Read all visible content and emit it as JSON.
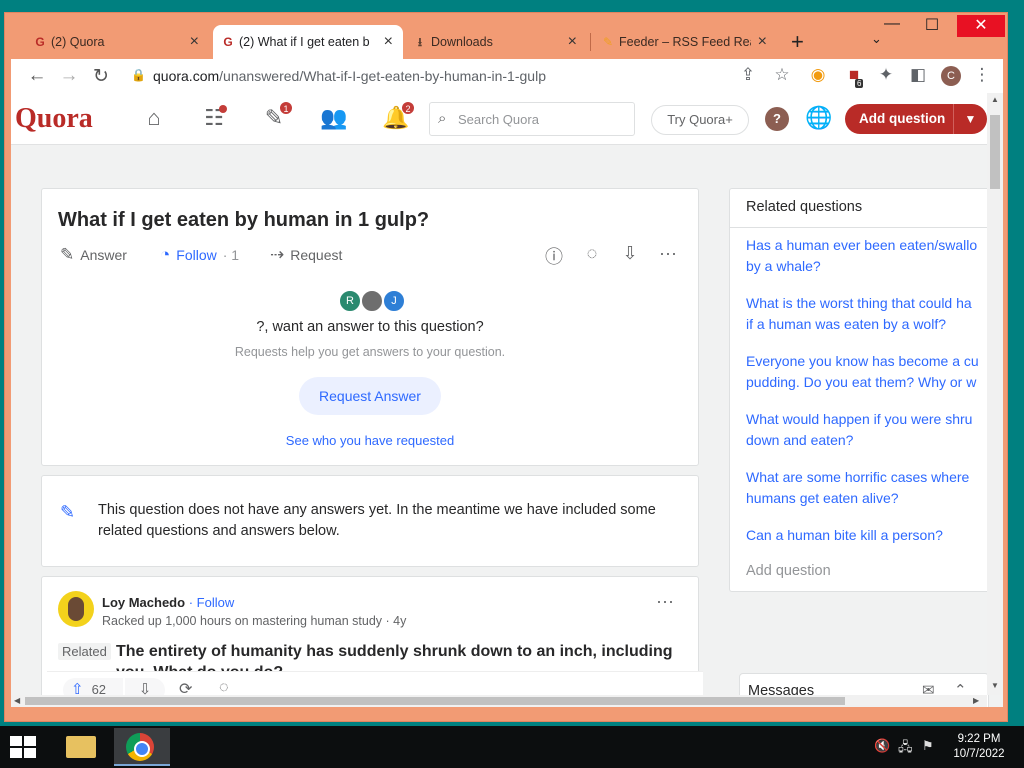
{
  "browser": {
    "tabs": [
      {
        "title": "(2) Quora",
        "icon": "quora-favicon"
      },
      {
        "title": "(2) What if I get eaten b",
        "icon": "quora-favicon",
        "active": true
      },
      {
        "title": "Downloads",
        "icon": "download-icon"
      },
      {
        "title": "Feeder – RSS Feed Rea",
        "icon": "feeder-favicon"
      }
    ],
    "close_glyph": "×",
    "url_host": "quora.com",
    "url_path": "/unanswered/What-if-I-get-eaten-by-human-in-1-gulp",
    "extension_badge": "6",
    "profile_initial": "C"
  },
  "quora": {
    "logo": "Quora",
    "badges": {
      "answer": "1",
      "notifications": "2"
    },
    "search_placeholder": "Search Quora",
    "try_label": "Try Quora+",
    "help_label": "?",
    "add_question_label": "Add question"
  },
  "question": {
    "title": "What if I get eaten by human in 1 gulp?",
    "answer_label": "Answer",
    "follow_label": "Follow",
    "follow_count": "· 1",
    "request_label": "Request",
    "avatars": [
      {
        "initial": "R",
        "color": "#2b8a6f"
      },
      {
        "initial": "",
        "color": "#6e6e6e"
      },
      {
        "initial": "J",
        "color": "#2e7fd6"
      }
    ],
    "prompt": "?, want an answer to this question?",
    "subprompt": "Requests help you get answers to your question.",
    "request_button": "Request Answer",
    "see_requested": "See who you have requested"
  },
  "no_answers": {
    "text": "This question does not have any answers yet. In the meantime we have included some related questions and answers below."
  },
  "post": {
    "author": "Loy Machedo",
    "follow": "· Follow",
    "meta": "Racked up 1,000 hours on mastering human study · 4y",
    "related_tag": "Related",
    "related_title": "The entirety of humanity has suddenly shrunk down to an inch, including you. What do you do?",
    "upvotes": "62"
  },
  "related": {
    "title": "Related questions",
    "items": [
      {
        "l1": "Has a human ever been eaten/swallo",
        "l2": "by a whale?"
      },
      {
        "l1": "What is the worst thing that could ha",
        "l2": "if a human was eaten by a wolf?"
      },
      {
        "l1": "Everyone you know has become a cu",
        "l2": "pudding. Do you eat them? Why or w"
      },
      {
        "l1": "What would happen if you were shru",
        "l2": "down and eaten?"
      },
      {
        "l1": "What are some horrific cases where",
        "l2": "humans get eaten alive?"
      },
      {
        "l1": "Can a human bite kill a person?",
        "l2": ""
      }
    ],
    "add_question": "Add question"
  },
  "messages": {
    "title": "Messages"
  },
  "taskbar": {
    "time": "9:22 PM",
    "date": "10/7/2022"
  }
}
